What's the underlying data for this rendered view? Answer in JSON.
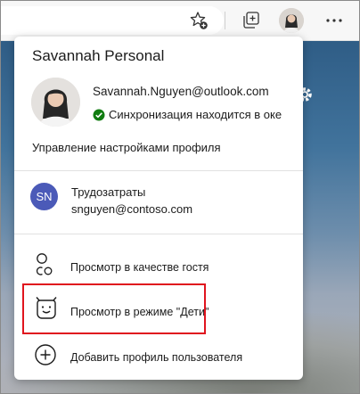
{
  "profile": {
    "name": "Savannah Personal",
    "email": "Savannah.Nguyen@outlook.com",
    "sync_status": "Синхронизация находится в оке",
    "manage_link": "Управление настройками профиля"
  },
  "work_profile": {
    "initials": "SN",
    "name": "Трудозатраты",
    "email": "snguyen@contoso.com"
  },
  "menu": {
    "guest": "Просмотр в качестве гостя",
    "kids": "Просмотр в режиме \"Дети\"",
    "add_profile": "Добавить профиль пользователя"
  },
  "icons": {
    "favorites": "favorites-add-icon",
    "collections": "collections-icon",
    "profile": "profile-avatar-icon",
    "more": "more-options-icon",
    "guest": "guest-icon",
    "kids": "kids-mode-icon",
    "add": "add-profile-icon",
    "sync": "sync-check-icon",
    "settings": "settings-gear-icon"
  },
  "colors": {
    "highlight": "#e0141e",
    "sync_check": "#107c10",
    "work_avatar": "#4b5ab8"
  }
}
